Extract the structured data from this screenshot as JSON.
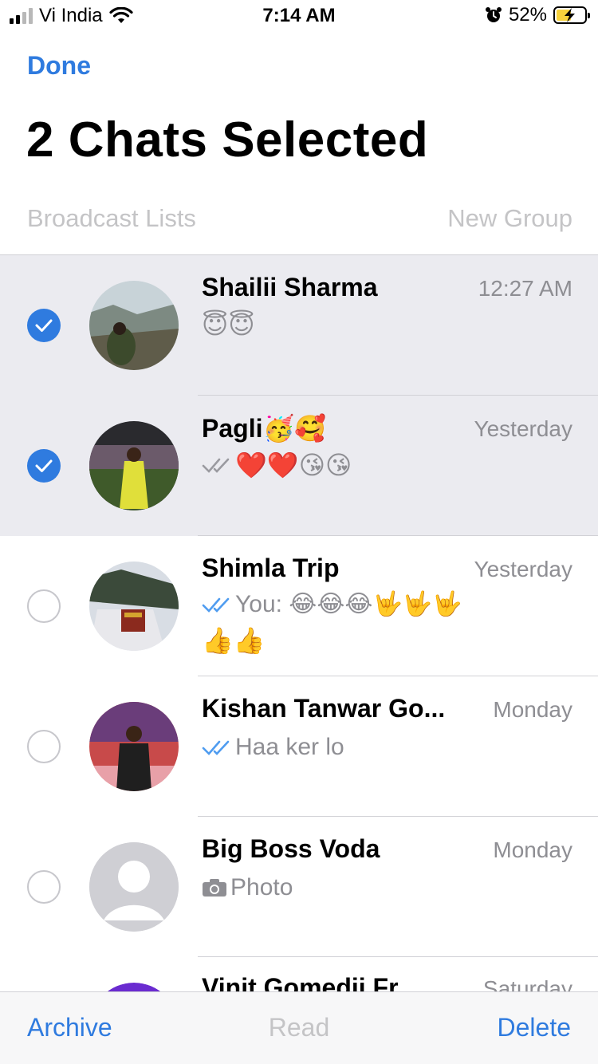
{
  "status_bar": {
    "carrier": "Vi India",
    "time": "7:14 AM",
    "battery": "52%",
    "battery_level": 0.52,
    "signal_bars": 2,
    "signal_total": 4
  },
  "header": {
    "done_label": "Done",
    "title": "2 Chats Selected",
    "broadcast_label": "Broadcast Lists",
    "new_group_label": "New Group"
  },
  "chats": [
    {
      "name": "Shailii Sharma",
      "time": "12:27 AM",
      "preview": "😇😇",
      "selected": true,
      "ticks": ""
    },
    {
      "name": "Pagli🥳🥰",
      "time": "Yesterday",
      "preview": "❤️❤️😘😘",
      "selected": true,
      "ticks": "gray"
    },
    {
      "name": "Shimla Trip",
      "time": "Yesterday",
      "preview": "You: 😂😂😂🤟🤟🤟",
      "preview_line2": "👍👍",
      "selected": false,
      "ticks": "blue"
    },
    {
      "name": "Kishan Tanwar Go...",
      "time": "Monday",
      "preview": "Haa ker lo",
      "selected": false,
      "ticks": "blue"
    },
    {
      "name": "Big Boss Voda",
      "time": "Monday",
      "preview": "Photo",
      "selected": false,
      "ticks": "",
      "icon": "camera-icon"
    },
    {
      "name": "Vinit Gomedii Fr...",
      "time": "Saturday",
      "preview": "",
      "selected": false,
      "ticks": ""
    }
  ],
  "toolbar": {
    "archive_label": "Archive",
    "read_label": "Read",
    "delete_label": "Delete"
  },
  "colors": {
    "accent": "#2f7bdf",
    "selected_row": "#ebebf0",
    "muted_text": "#8e8e93",
    "disabled_text": "#c4c4c6"
  }
}
